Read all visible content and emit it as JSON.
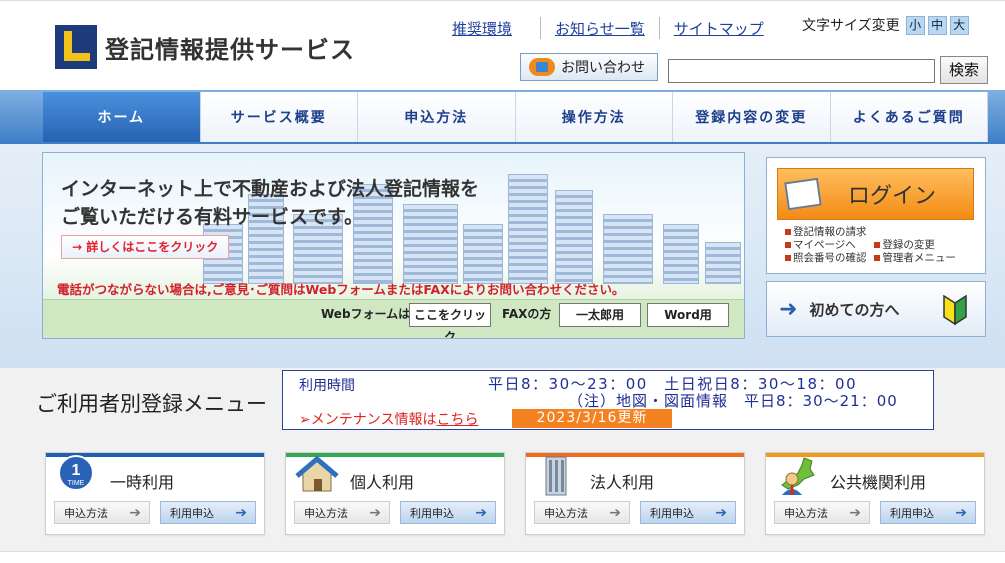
{
  "header": {
    "logo_text": "登記情報提供サービス",
    "links": {
      "recommend": "推奨環境",
      "news": "お知らせ一覧",
      "sitemap": "サイトマップ"
    },
    "font_size_label": "文字サイズ変更",
    "font_sizes": [
      "小",
      "中",
      "大"
    ],
    "contact_label": "お問い合わせ",
    "search_value": "",
    "search_button": "検索"
  },
  "nav": {
    "items": [
      "ホーム",
      "サービス概要",
      "申込方法",
      "操作方法",
      "登録内容の変更",
      "よくあるご質問"
    ],
    "active_index": 0
  },
  "banner": {
    "headline_line1": "インターネット上で不動産および法人登記情報を",
    "headline_line2": "ご覧いただける有料サービスです。",
    "details_link": "→ 詳しくはここをクリック",
    "warning": "電話がつながらない場合は,ご意見･ご質問はWebフォームまたはFAXによりお問い合わせください。",
    "webform_label": "Webフォームは",
    "webform_button": "ここをクリック",
    "fax_label": "FAXの方",
    "fax_ichitaro": "一太郎用",
    "fax_word": "Word用"
  },
  "login": {
    "button": "ログイン",
    "links": {
      "request": "登記情報の請求",
      "mypage": "マイページへ",
      "change": "登録の変更",
      "lookup": "照会番号の確認",
      "admin": "管理者メニュー"
    }
  },
  "first_time": "初めての方へ",
  "registration": {
    "title": "ご利用者別登録メニュー",
    "hours_label": "利用時間",
    "hours_line1": "平日8：30～23：00　土日祝日8：30～18：00",
    "hours_line2": "（注）地図・図面情報　平日8：30～21：00",
    "maintenance_prefix": "➢メンテナンス情報は",
    "maintenance_link": "こちら",
    "updated": "2023/3/16更新",
    "cards": [
      {
        "title": "一時利用",
        "stripe": "#1f5fb1",
        "how": "申込方法",
        "apply": "利用申込"
      },
      {
        "title": "個人利用",
        "stripe": "#33a851",
        "how": "申込方法",
        "apply": "利用申込"
      },
      {
        "title": "法人利用",
        "stripe": "#ee6b1f",
        "how": "申込方法",
        "apply": "利用申込"
      },
      {
        "title": "公共機関利用",
        "stripe": "#f09a1a",
        "how": "申込方法",
        "apply": "利用申込"
      }
    ]
  }
}
